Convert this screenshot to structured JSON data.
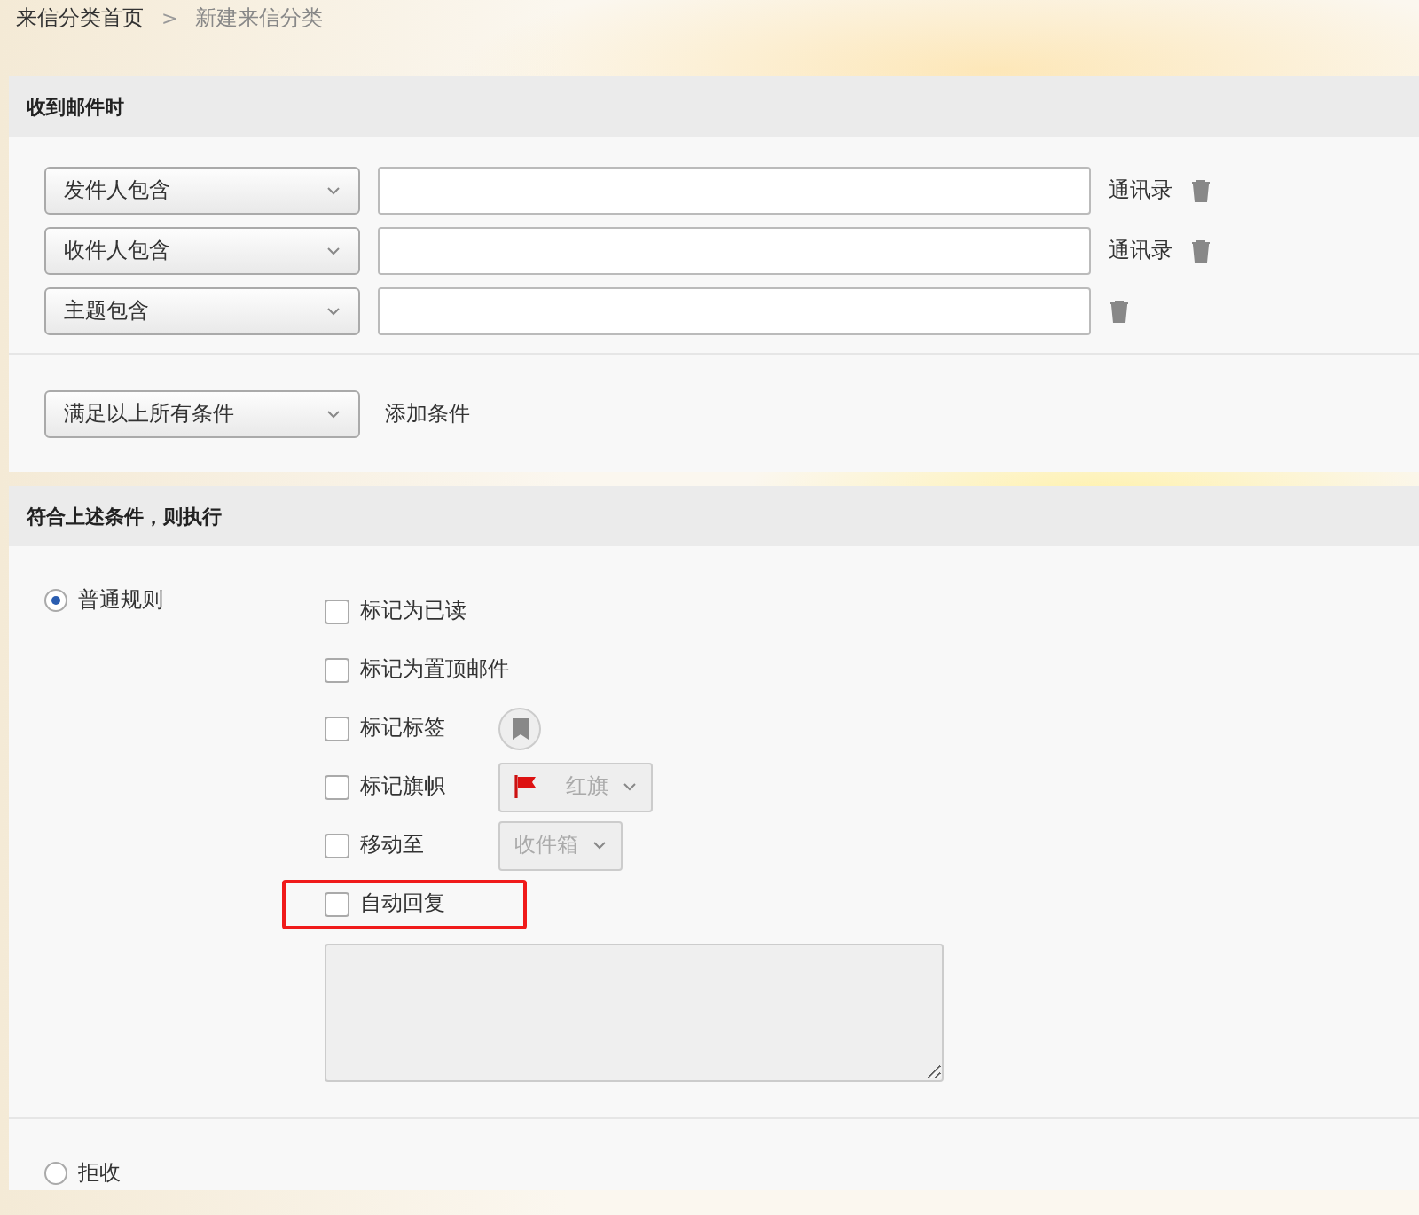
{
  "breadcrumb": [
    {
      "label": "来信分类首页",
      "link": true
    },
    {
      "label": "新建来信分类",
      "link": false
    }
  ],
  "breadcrumb_separator": ">",
  "conditions_panel": {
    "title": "收到邮件时",
    "conditions": [
      {
        "field": "发件人包含",
        "contacts_link": "通讯录"
      },
      {
        "field": "收件人包含",
        "contacts_link": "通讯录"
      },
      {
        "field": "主题包含"
      }
    ],
    "match_mode": "满足以上所有条件",
    "add_condition": "添加条件"
  },
  "actions_panel": {
    "title": "符合上述条件，则执行",
    "rule_types": [
      {
        "label": "普通规则",
        "selected": true
      },
      {
        "label": "拒收",
        "selected": false
      }
    ],
    "actions": [
      {
        "kind": "plain",
        "label": "标记为已读",
        "checked": false,
        "highlighted": false
      },
      {
        "kind": "plain",
        "label": "标记为置顶邮件",
        "checked": false,
        "highlighted": false
      },
      {
        "kind": "tag",
        "label": "标记标签",
        "checked": false,
        "highlighted": false
      },
      {
        "kind": "flag",
        "label": "标记旗帜",
        "checked": false,
        "highlighted": false,
        "option": "红旗"
      },
      {
        "kind": "folder",
        "label": "移动至",
        "checked": false,
        "highlighted": false,
        "option": "收件箱"
      },
      {
        "kind": "reply",
        "label": "自动回复",
        "checked": false,
        "highlighted": true
      }
    ]
  }
}
